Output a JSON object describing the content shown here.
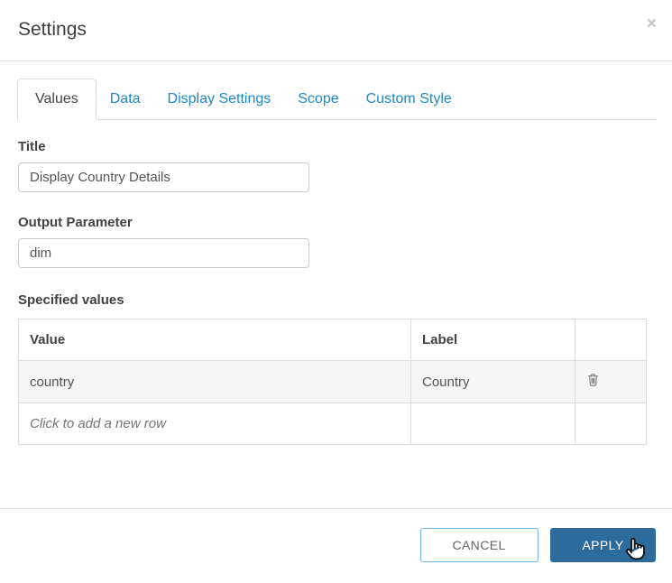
{
  "modal": {
    "title": "Settings",
    "close_glyph": "×"
  },
  "tabs": [
    {
      "label": "Values",
      "active": true
    },
    {
      "label": "Data",
      "active": false
    },
    {
      "label": "Display Settings",
      "active": false
    },
    {
      "label": "Scope",
      "active": false
    },
    {
      "label": "Custom Style",
      "active": false
    }
  ],
  "form": {
    "title_label": "Title",
    "title_value": "Display Country Details",
    "output_label": "Output Parameter",
    "output_value": "dim",
    "specified_label": "Specified values"
  },
  "table": {
    "headers": [
      "Value",
      "Label",
      ""
    ],
    "rows": [
      {
        "value": "country",
        "label": "Country",
        "action": "trash-icon"
      }
    ],
    "add_row_text": "Click to add a new row"
  },
  "footer": {
    "cancel_label": "CANCEL",
    "apply_label": "APPLY"
  },
  "colors": {
    "tab_link": "#1e88c7",
    "active_tab_text": "#444444",
    "apply_bg": "#2e6b9d",
    "cancel_border": "#6fadde",
    "row_stripe": "#f5f5f5",
    "table_border": "#dddddd"
  }
}
